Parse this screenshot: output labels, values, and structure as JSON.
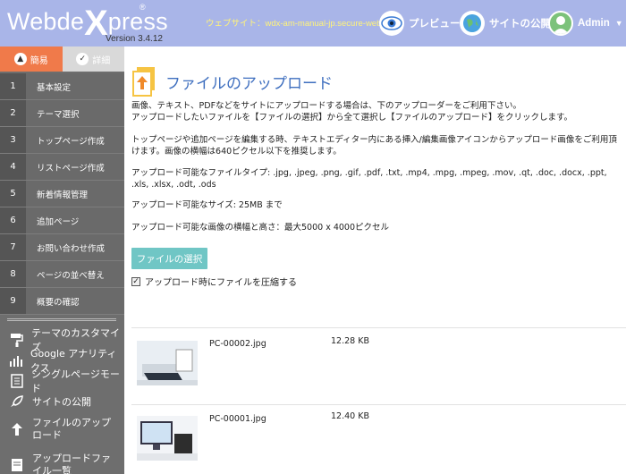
{
  "header": {
    "logo_main": "Webde",
    "logo_x": "X",
    "logo_rest": "press",
    "logo_reg": "®",
    "version": "Version 3.4.12",
    "site_link": "ウェブサイト：wdx-am-manual-jp.secure-web.jp",
    "preview_label": "プレビュー",
    "publish_label": "サイトの公開",
    "admin_label": "Admin",
    "accent_color": "#a9b5e8"
  },
  "sidebar": {
    "modes": [
      {
        "label": "簡易",
        "icon": "user-icon"
      },
      {
        "label": "詳細",
        "icon": "gear-icon"
      }
    ],
    "steps": [
      {
        "num": "1",
        "label": "基本設定"
      },
      {
        "num": "2",
        "label": "テーマ選択"
      },
      {
        "num": "3",
        "label": "トップページ作成"
      },
      {
        "num": "4",
        "label": "リストページ作成"
      },
      {
        "num": "5",
        "label": "新着情報管理"
      },
      {
        "num": "6",
        "label": "追加ページ"
      },
      {
        "num": "7",
        "label": "お問い合わせ作成"
      },
      {
        "num": "8",
        "label": "ページの並べ替え"
      },
      {
        "num": "9",
        "label": "概要の確認"
      }
    ],
    "tools": [
      {
        "label": "テーマのカスタマイズ",
        "icon": "paint-roller-icon"
      },
      {
        "label": "Google アナリティクス",
        "icon": "bar-chart-icon"
      },
      {
        "label": "シングルページモード",
        "icon": "document-icon"
      },
      {
        "label": "サイトの公開",
        "icon": "rocket-icon"
      },
      {
        "label": "ファイルのアップロード",
        "icon": "upload-icon"
      },
      {
        "label": "アップロードファイル一覧",
        "icon": "file-list-icon"
      }
    ]
  },
  "main": {
    "title": "ファイルのアップロード",
    "intro_1": "画像、テキスト、PDFなどをサイトにアップロードする場合は、下のアップローダーをご利用下さい。",
    "intro_2": "アップロードしたいファイルを【ファイルの選択】から全て選択し【ファイルのアップロード】をクリックします。",
    "editor_1": "トップページや追加ページを編集する時、テキストエディター内にある挿入/編集画像アイコンからアップロード画像をご利用頂けます。画像の横幅は640ピクセル以下を推奨します。",
    "types": "アップロード可能なファイルタイプ: .jpg, .jpeg, .png, .gif, .pdf, .txt, .mp4, .mpg, .mpeg, .mov, .qt, .doc, .docx, .ppt, .xls, .xlsx, .odt, .ods",
    "size": "アップロード可能なサイズ: 25MB まで",
    "dimensions": "アップロード可能な画像の横幅と高さ：最大5000 x 4000ピクセル",
    "choose_button": "ファイルの選択",
    "compress_label": "アップロード時にファイルを圧縮する",
    "compress_checked": true,
    "files": [
      {
        "name": "PC-00002.jpg",
        "size": "12.28 KB"
      },
      {
        "name": "PC-00001.jpg",
        "size": "12.40 KB"
      }
    ]
  }
}
